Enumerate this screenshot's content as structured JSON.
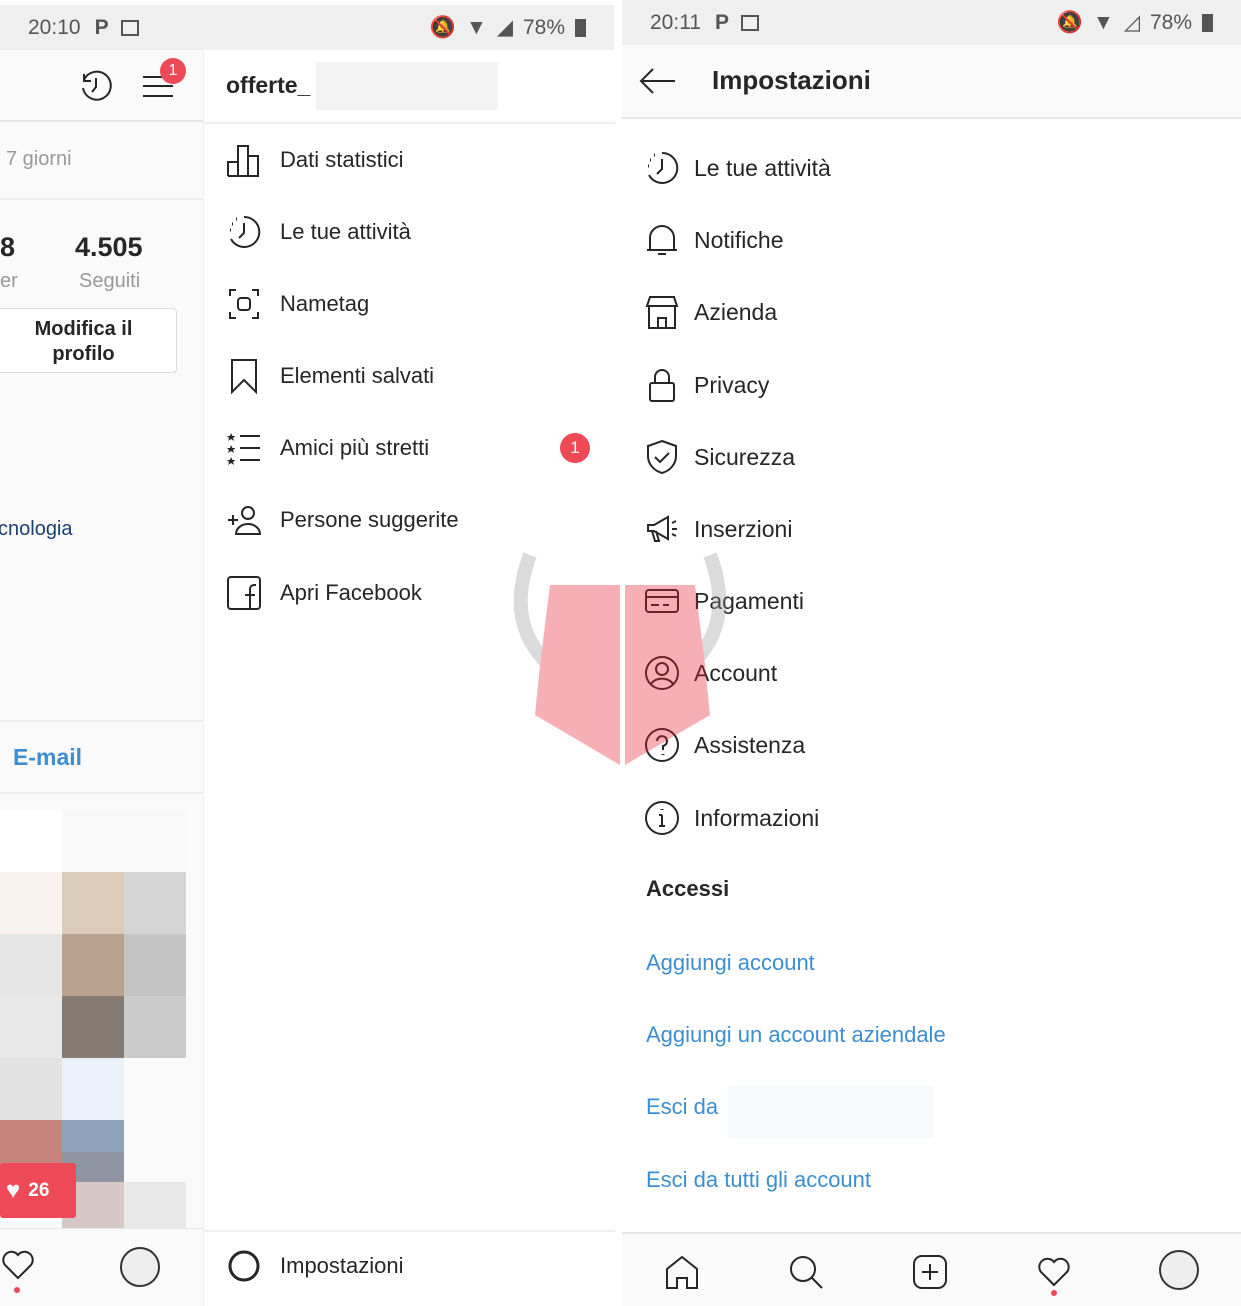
{
  "left_phone": {
    "status": {
      "time": "20:10",
      "battery": "78%"
    },
    "profile": {
      "period_text": "7 giorni",
      "followers_count_partial": "8",
      "followers_label_partial": "er",
      "following_count": "4.505",
      "following_label": "Seguiti",
      "edit_button": "Modifica il profilo",
      "category_partial": "cnologia",
      "email_button": "E-mail",
      "menu_badge": "1",
      "likes_popup": "26"
    },
    "drawer": {
      "username": "offerte_",
      "items": [
        {
          "icon": "bar-chart-icon",
          "label": "Dati statistici"
        },
        {
          "icon": "activity-clock-icon",
          "label": "Le tue attività"
        },
        {
          "icon": "nametag-icon",
          "label": "Nametag"
        },
        {
          "icon": "bookmark-icon",
          "label": "Elementi salvati"
        },
        {
          "icon": "close-friends-list-icon",
          "label": "Amici più stretti",
          "badge": "1"
        },
        {
          "icon": "add-person-icon",
          "label": "Persone suggerite"
        },
        {
          "icon": "facebook-icon",
          "label": "Apri Facebook"
        }
      ],
      "settings_label": "Impostazioni"
    }
  },
  "right_phone": {
    "status": {
      "time": "20:11",
      "battery": "78%"
    },
    "header": {
      "title": "Impostazioni"
    },
    "items": [
      {
        "icon": "activity-clock-icon",
        "label": "Le tue attività"
      },
      {
        "icon": "bell-icon",
        "label": "Notifiche"
      },
      {
        "icon": "shop-icon",
        "label": "Azienda"
      },
      {
        "icon": "lock-icon",
        "label": "Privacy"
      },
      {
        "icon": "shield-icon",
        "label": "Sicurezza"
      },
      {
        "icon": "megaphone-icon",
        "label": "Inserzioni"
      },
      {
        "icon": "credit-card-icon",
        "label": "Pagamenti"
      },
      {
        "icon": "account-circle-icon",
        "label": "Account"
      },
      {
        "icon": "help-icon",
        "label": "Assistenza"
      },
      {
        "icon": "info-icon",
        "label": "Informazioni"
      }
    ],
    "section_title": "Accessi",
    "links": [
      "Aggiungi account",
      "Aggiungi un account aziendale",
      "Esci da",
      "Esci da tutti gli account"
    ]
  },
  "colors": {
    "link": "#3d8ed0",
    "badge": "#ed4956",
    "status_bar": "#efefef"
  }
}
